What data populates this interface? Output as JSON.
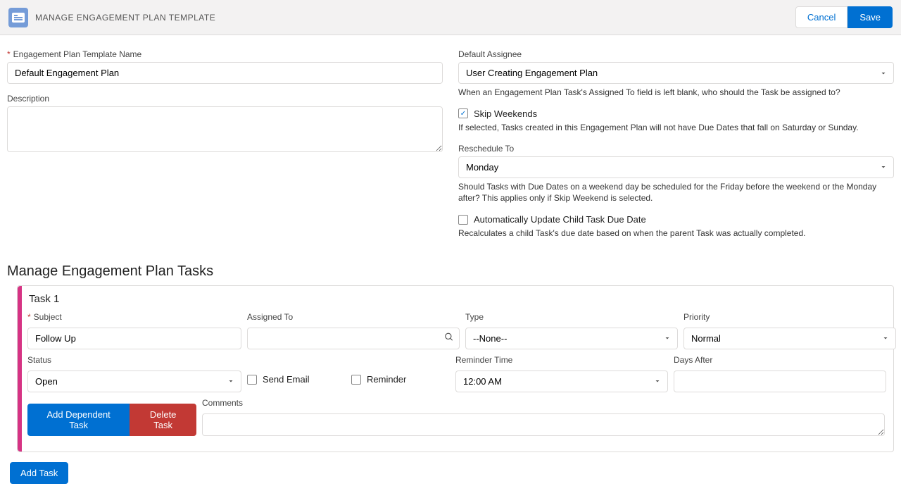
{
  "header": {
    "title": "MANAGE ENGAGEMENT PLAN TEMPLATE",
    "cancel": "Cancel",
    "save": "Save"
  },
  "form": {
    "name_label": "Engagement Plan Template Name",
    "name_value": "Default Engagement Plan",
    "description_label": "Description",
    "description_value": "",
    "assignee_label": "Default Assignee",
    "assignee_value": "User Creating Engagement Plan",
    "assignee_help": "When an Engagement Plan Task's Assigned To field is left blank, who should the Task be assigned to?",
    "skip_weekends_label": "Skip Weekends",
    "skip_weekends_help": "If selected, Tasks created in this Engagement Plan will not have Due Dates that fall on Saturday or Sunday.",
    "reschedule_label": "Reschedule To",
    "reschedule_value": "Monday",
    "reschedule_help": "Should Tasks with Due Dates on a weekend day be scheduled for the Friday before the weekend or the Monday after? This applies only if Skip Weekend is selected.",
    "auto_update_label": "Automatically Update Child Task Due Date",
    "auto_update_help": "Recalculates a child Task's due date based on when the parent Task was actually completed."
  },
  "tasks": {
    "section_title": "Manage Engagement Plan Tasks",
    "task1": {
      "title": "Task 1",
      "subject_label": "Subject",
      "subject_value": "Follow Up",
      "assigned_to_label": "Assigned To",
      "assigned_to_value": "",
      "type_label": "Type",
      "type_value": "--None--",
      "priority_label": "Priority",
      "priority_value": "Normal",
      "status_label": "Status",
      "status_value": "Open",
      "send_email_label": "Send Email",
      "reminder_label": "Reminder",
      "reminder_time_label": "Reminder Time",
      "reminder_time_value": "12:00 AM",
      "days_after_label": "Days After",
      "days_after_value": "",
      "comments_label": "Comments",
      "comments_value": "",
      "add_dependent": "Add Dependent Task",
      "delete_task": "Delete Task"
    },
    "add_task": "Add Task"
  }
}
